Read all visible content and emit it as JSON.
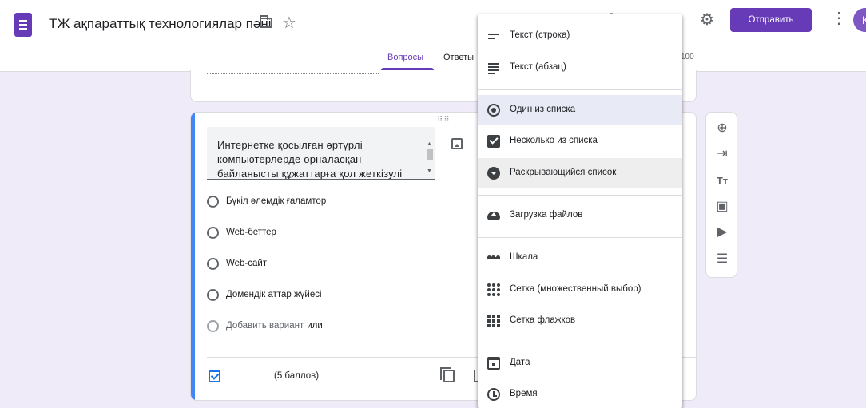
{
  "header": {
    "title": "ТЖ ақпараттық технологиялар пәні",
    "send_label": "Отправить",
    "avatar_letter": "К",
    "tabs": [
      {
        "label": "Вопросы"
      },
      {
        "label": "Ответы"
      }
    ],
    "points_total": "100"
  },
  "question_card": {
    "question_text": "Интернетке қосылған әртүрлі компьютерлерде орналасқан байланысты құжаттарға қол жеткізулі",
    "options": [
      {
        "label": "Бүкіл әлемдік ғаламтор"
      },
      {
        "label": "Web-беттер"
      },
      {
        "label": "Web-сайт"
      },
      {
        "label": "Домендік аттар жүйесі"
      }
    ],
    "add_option_label": "Добавить вариант",
    "or_label": "или",
    "points_label": "(5 баллов)"
  },
  "menu": {
    "items": [
      {
        "label": "Текст (строка)",
        "icon": "short-text-icon"
      },
      {
        "label": "Текст (абзац)",
        "icon": "paragraph-icon"
      },
      {
        "label": "Один из списка",
        "icon": "radio-icon",
        "state": "selected"
      },
      {
        "label": "Несколько из списка",
        "icon": "checkbox-icon"
      },
      {
        "label": "Раскрывающийся список",
        "icon": "dropdown-icon",
        "state": "hover"
      },
      {
        "label": "Загрузка файлов",
        "icon": "upload-icon"
      },
      {
        "label": "Шкала",
        "icon": "linear-scale-icon"
      },
      {
        "label": "Сетка (множественный выбор)",
        "icon": "grid-icon"
      },
      {
        "label": "Сетка флажков",
        "icon": "checkbox-grid-icon"
      },
      {
        "label": "Дата",
        "icon": "calendar-icon"
      },
      {
        "label": "Время",
        "icon": "clock-icon"
      }
    ]
  },
  "side_toolbar": {
    "tools": [
      "add-question-icon",
      "import-questions-icon",
      "add-title-icon",
      "add-image-icon",
      "add-video-icon",
      "add-section-icon"
    ]
  },
  "colors": {
    "accent": "#673ab7",
    "question_accent": "#4285f4",
    "background": "#f0ebf8"
  }
}
